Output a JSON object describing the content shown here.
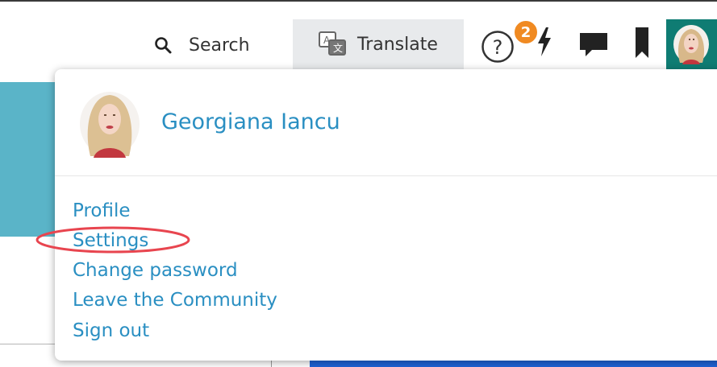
{
  "topbar": {
    "search_label": "Search",
    "translate_label": "Translate",
    "notifications_count": "2"
  },
  "user_menu": {
    "user_name": "Georgiana Iancu",
    "items": [
      {
        "label": "Profile"
      },
      {
        "label": "Settings"
      },
      {
        "label": "Change password"
      },
      {
        "label": "Leave the Community"
      },
      {
        "label": "Sign out"
      }
    ]
  },
  "colors": {
    "link": "#2a8fc2",
    "avatar_tile": "#0f7c73",
    "badge": "#f08a22",
    "highlight": "#e8454f"
  }
}
